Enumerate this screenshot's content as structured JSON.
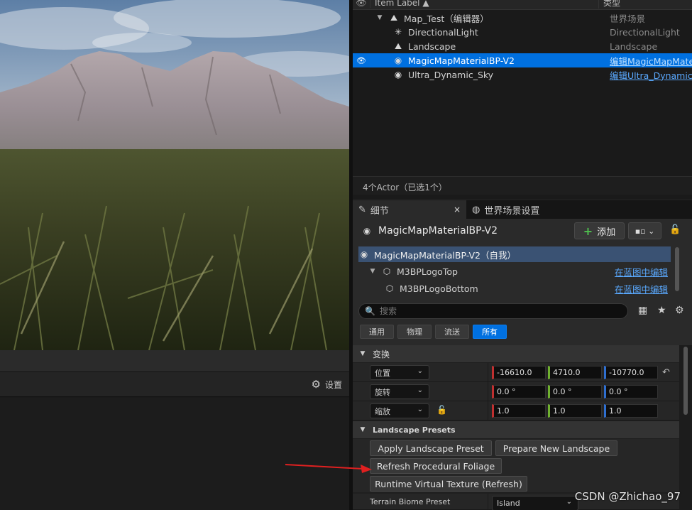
{
  "outliner": {
    "header": {
      "label_col": "Item Label ▲",
      "type_col": "类型",
      "eye": "👁"
    },
    "rows": [
      {
        "name": "Map_Test（编辑器）",
        "type": "世界场景",
        "icon": "map-icon",
        "glyph": "⛰"
      },
      {
        "name": "DirectionalLight",
        "type": "DirectionalLight",
        "icon": "directional-light-icon",
        "glyph": "✳"
      },
      {
        "name": "Landscape",
        "type": "Landscape",
        "icon": "landscape-icon",
        "glyph": "⛰"
      },
      {
        "name": "MagicMapMaterialBP-V2",
        "type": "编辑MagicMapMater",
        "icon": "blueprint-actor-icon",
        "glyph": "◉",
        "selected": true,
        "eye": "👁"
      },
      {
        "name": "Ultra_Dynamic_Sky",
        "type": "编辑Ultra_Dynamic_",
        "icon": "blueprint-actor-icon",
        "glyph": "◉"
      }
    ],
    "actor_count": "4个Actor（已选1个）"
  },
  "tabs": {
    "details": "细节",
    "details_icon": "pencil-icon",
    "close": "×",
    "world_settings": "世界场景设置",
    "world_icon": "globe-icon"
  },
  "details": {
    "title": "MagicMapMaterialBP-V2",
    "add_label": "添加",
    "add_plus": "+",
    "blueprint_glyph": "▪▫ ⌄",
    "lock_glyph": "🔓"
  },
  "components": [
    {
      "name": "MagicMapMaterialBP-V2（自我）",
      "link": "",
      "selected": true
    },
    {
      "name": "M3BPLogoTop",
      "link": "在蓝图中编辑"
    },
    {
      "name": "M3BPLogoBottom",
      "link": "在蓝图中编辑"
    }
  ],
  "search": {
    "placeholder": "搜索",
    "icons": {
      "table": "▦",
      "star": "★",
      "gear": "⚙"
    }
  },
  "filters": [
    "通用",
    "物理",
    "流送",
    "所有"
  ],
  "active_filter": "所有",
  "transform": {
    "section": "变换",
    "rows": [
      {
        "label": "位置",
        "x": "-16610.0",
        "y": "4710.0",
        "z": "-10770.0"
      },
      {
        "label": "旋转",
        "x": "0.0 °",
        "y": "0.0 °",
        "z": "0.0 °"
      },
      {
        "label": "缩放",
        "x": "1.0",
        "y": "1.0",
        "z": "1.0"
      }
    ],
    "reset_glyph": "↶",
    "lock_glyph": "🔓"
  },
  "landscape_presets": {
    "section": "Landscape Presets",
    "buttons": {
      "apply": "Apply Landscape Preset",
      "prepare": "Prepare New Landscape",
      "refresh_foliage": "Refresh Procedural Foliage",
      "runtime_vt": "Runtime Virtual Texture (Refresh)"
    },
    "terrain_biome_label": "Terrain Biome Preset",
    "terrain_biome_value": "Island"
  },
  "viewport": {
    "settings_label": "设置",
    "settings_glyph": "⚙"
  },
  "watermark": "CSDN @Zhichao_97",
  "colors": {
    "selection": "#0070e0",
    "link": "#5aa9ff",
    "annotation_arrow": "#e02020"
  }
}
